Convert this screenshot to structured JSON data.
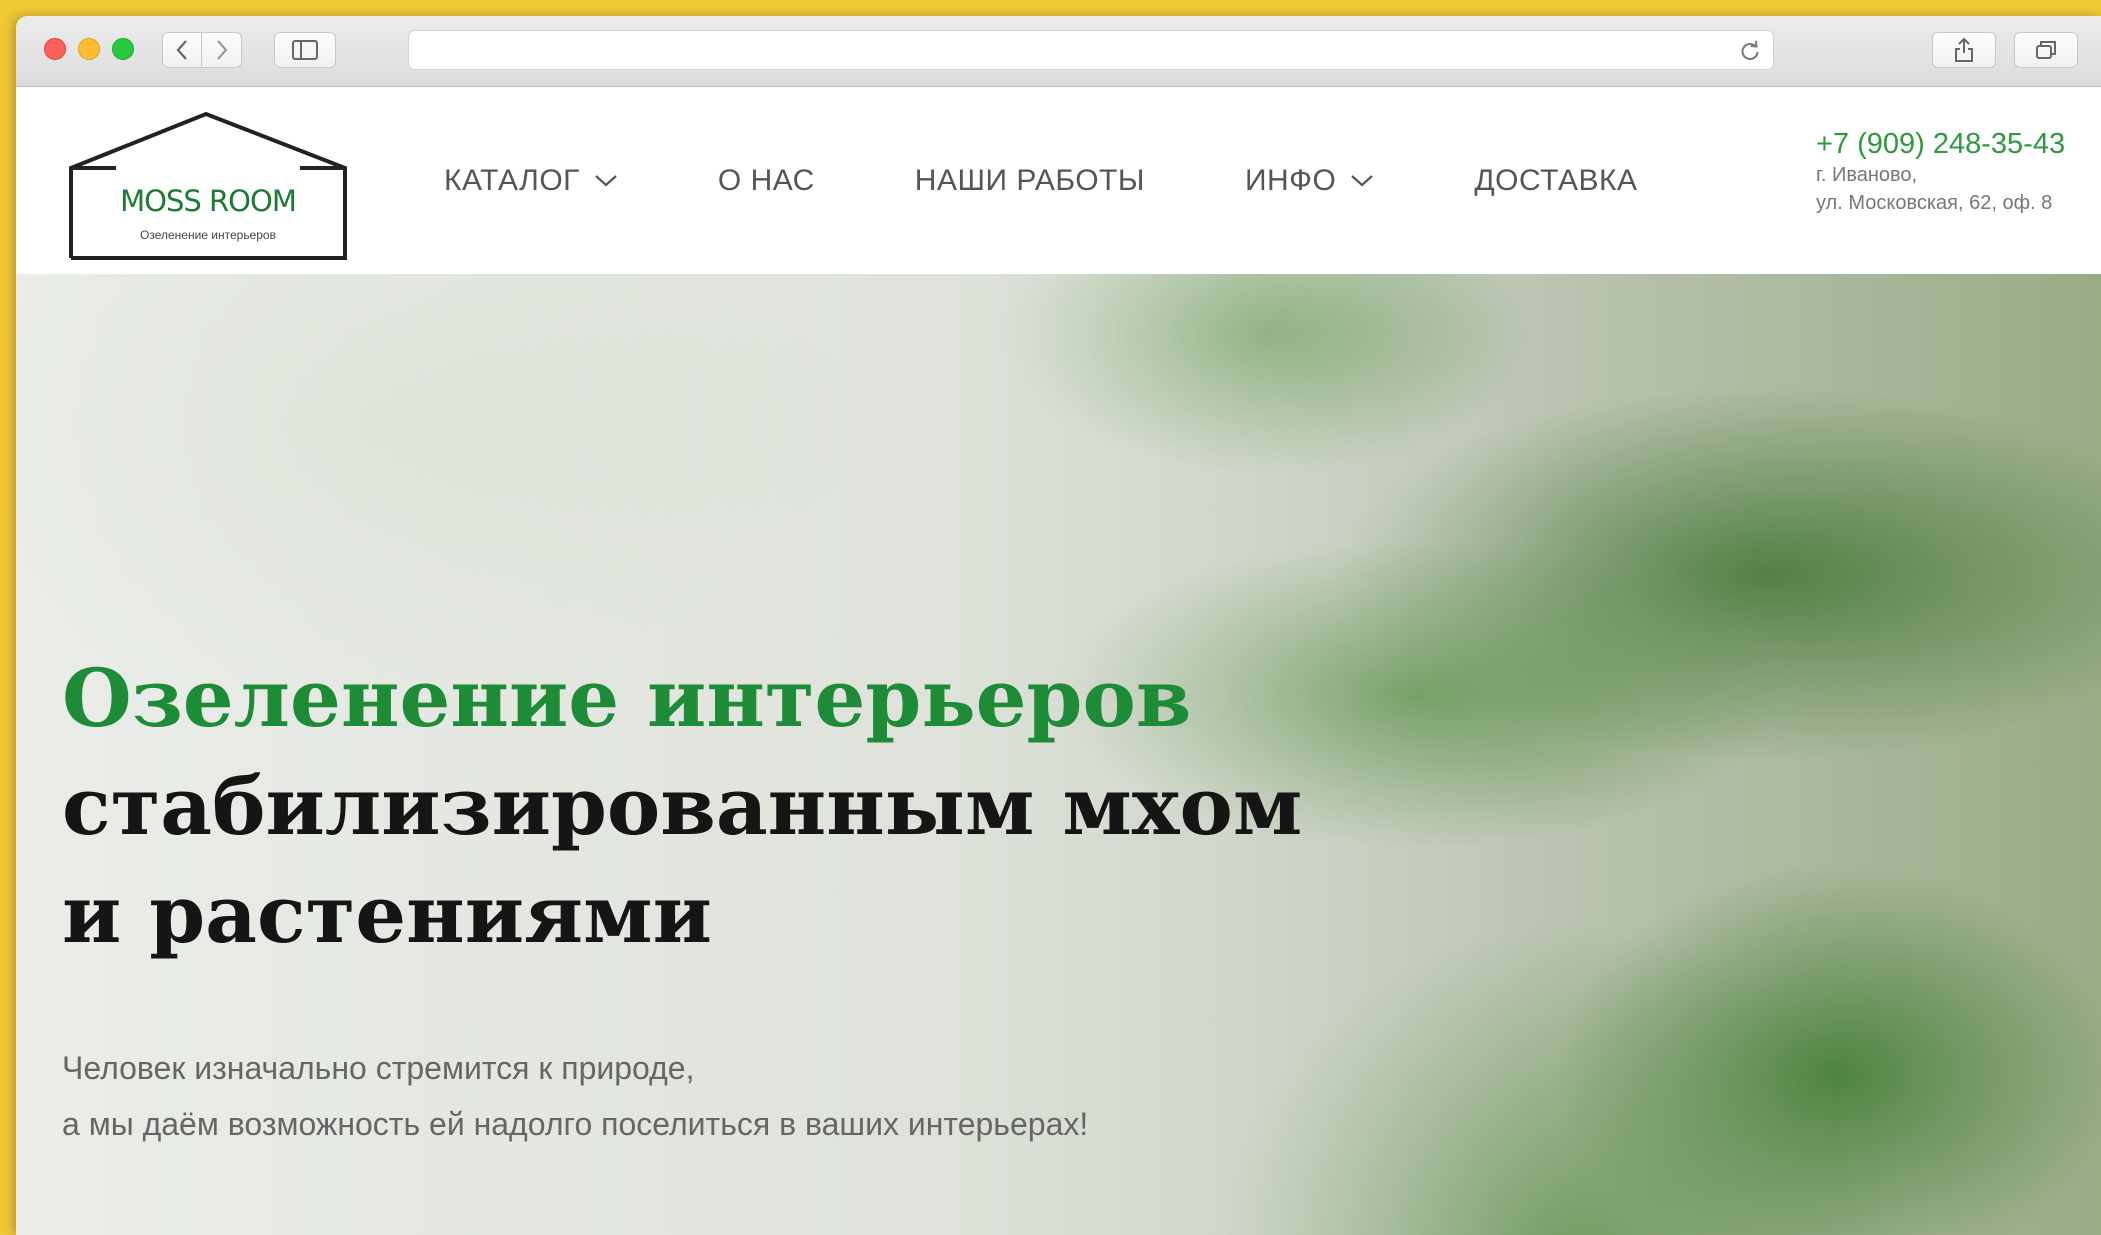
{
  "browser": {
    "url": "",
    "icons": {
      "back": "chevron-left-icon",
      "forward": "chevron-right-icon",
      "sidebar": "sidebar-icon",
      "reload": "reload-icon",
      "share": "share-icon",
      "tabs": "tabs-overview-icon"
    }
  },
  "site": {
    "logo": {
      "title": "MOSS ROOM",
      "subtitle": "Озеленение интерьеров"
    },
    "nav": {
      "catalog": "КАТАЛОГ",
      "about": "О НАС",
      "works": "НАШИ РАБОТЫ",
      "info": "ИНФО",
      "delivery": "ДОСТАВКА"
    },
    "contacts": {
      "phone": "+7 (909) 248-35-43",
      "city": "г. Иваново,",
      "street": "ул. Московская, 62, оф. 8"
    }
  },
  "hero": {
    "headline_green": "Озеленение интерьеров",
    "headline_line2": "стабилизированным мхом",
    "headline_line3": "и растениями",
    "sub_line1": "Человек изначально стремится к природе,",
    "sub_line2": "а мы даём возможность ей надолго поселиться в ваших интерьерах!"
  },
  "colors": {
    "accent_green": "#1e8c36",
    "phone_green": "#2e9a3e",
    "desktop_yellow": "#f0c935"
  }
}
